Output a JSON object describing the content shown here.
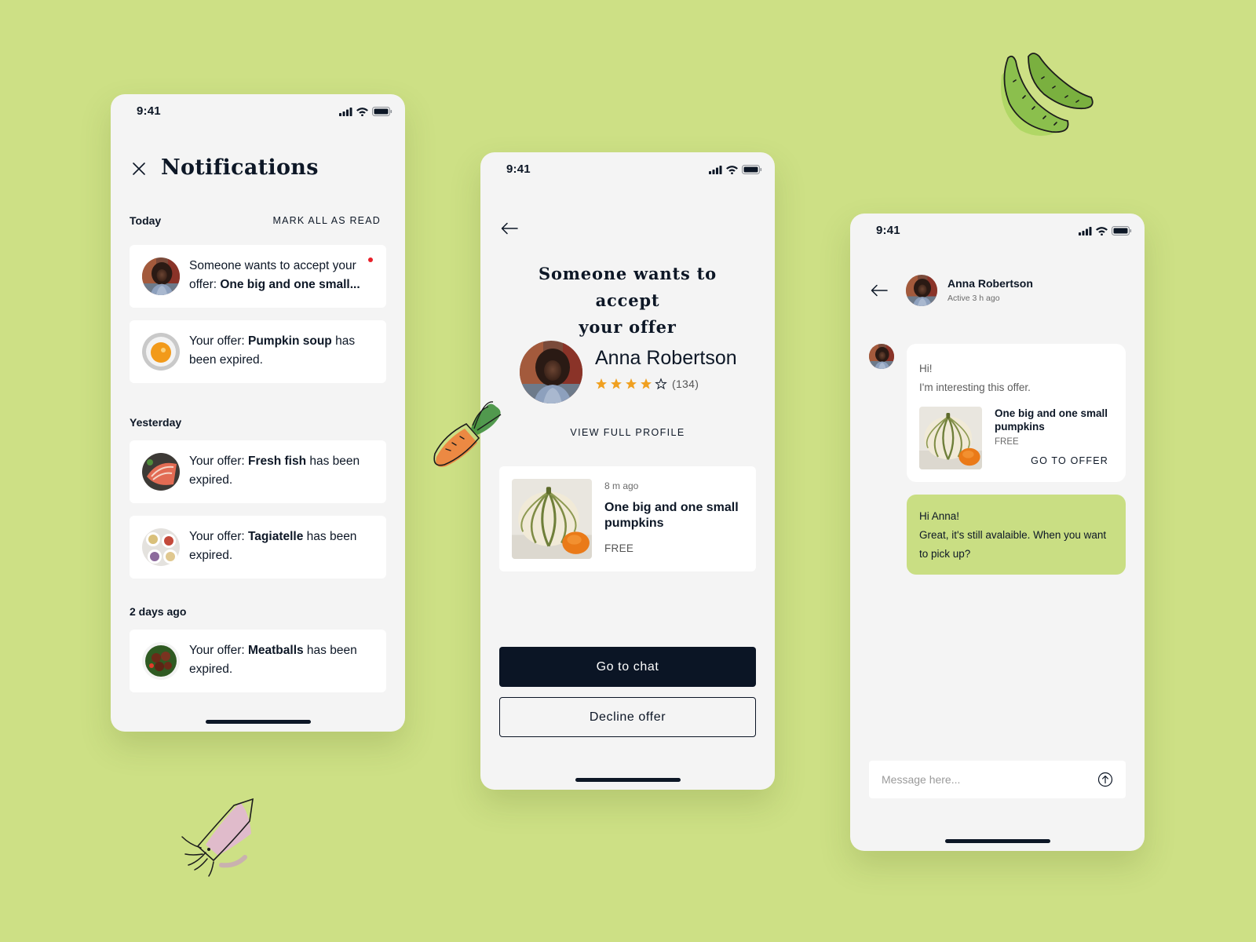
{
  "status_bar": {
    "time": "9:41"
  },
  "notifications_screen": {
    "title": "Notifications",
    "mark_all_read": "MARK ALL AS READ",
    "sections": [
      {
        "label": "Today"
      },
      {
        "label": "Yesterday"
      },
      {
        "label": "2 days ago"
      }
    ],
    "items": [
      {
        "prefix": "Someone wants to accept your offer: ",
        "bold": "One big and one small...",
        "suffix": "",
        "unread": true
      },
      {
        "prefix": "Your offer: ",
        "bold": "Pumpkin soup",
        "suffix": " has been expired.",
        "unread": false
      },
      {
        "prefix": "Your offer: ",
        "bold": "Fresh fish",
        "suffix": " has been expired.",
        "unread": false
      },
      {
        "prefix": "Your offer: ",
        "bold": "Tagiatelle",
        "suffix": " has been expired.",
        "unread": false
      },
      {
        "prefix": "Your offer: ",
        "bold": "Meatballs",
        "suffix": " has been expired.",
        "unread": false
      }
    ]
  },
  "offer_screen": {
    "title_line1": "Someone wants to accept",
    "title_line2": "your offer",
    "user_name": "Anna Robertson",
    "rating": 4,
    "rating_max": 5,
    "rating_count": "(134)",
    "view_profile": "VIEW FULL PROFILE",
    "offer": {
      "time_ago": "8 m ago",
      "name": "One big and one small pumpkins",
      "price": "FREE"
    },
    "go_to_chat": "Go to chat",
    "decline": "Decline offer"
  },
  "chat_screen": {
    "contact_name": "Anna Robertson",
    "contact_status": "Active 3 h ago",
    "incoming": {
      "line1": "Hi!",
      "line2": "I'm interesting this offer.",
      "product_name": "One big and one small pumpkins",
      "product_price": "FREE",
      "go_to_offer": "GO TO OFFER"
    },
    "outgoing": {
      "line1": "Hi Anna!",
      "line2": "Great, it's still avalaible. When you want to pick up?"
    },
    "input_placeholder": "Message here..."
  },
  "colors": {
    "background": "#cde085",
    "card": "#ffffff",
    "screen": "#f4f4f4",
    "dark": "#0b1525",
    "accent_green": "#c9de83",
    "star": "#f0a020",
    "unread": "#e8202a"
  },
  "icons": [
    "close-icon",
    "back-arrow-icon",
    "star-icon",
    "send-icon",
    "signal-icon",
    "wifi-icon",
    "battery-icon"
  ]
}
